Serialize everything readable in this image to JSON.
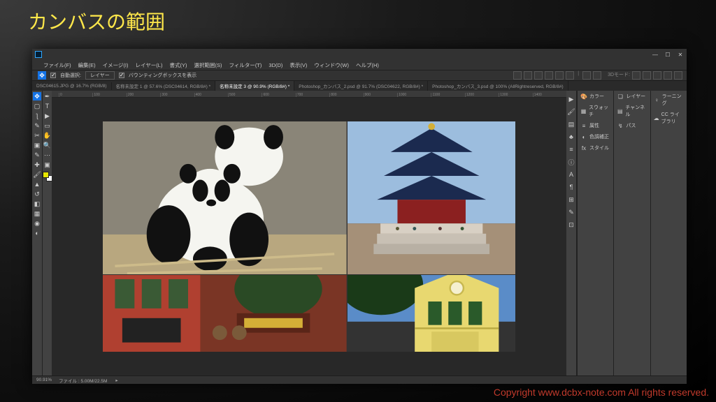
{
  "overlay": {
    "title": "カンバスの範囲",
    "copyright": "Copyright www.dcbx-note.com All rights reserved."
  },
  "menu": {
    "items": [
      "ファイル(F)",
      "編集(E)",
      "イメージ(I)",
      "レイヤー(L)",
      "書式(Y)",
      "選択範囲(S)",
      "フィルター(T)",
      "3D(D)",
      "表示(V)",
      "ウィンドウ(W)",
      "ヘルプ(H)"
    ]
  },
  "options": {
    "auto_select_label": "自動選択:",
    "auto_select_target": "レイヤー",
    "bbox_label": "バウンティングボックスを表示",
    "mode_label": "3Dモード:"
  },
  "tabs": [
    {
      "label": "DSC04615.JPG @ 16.7% (RGB/8)",
      "active": false
    },
    {
      "label": "名称未設定 1 @ 57.6% (DSC04614, RGB/8#) *",
      "active": false
    },
    {
      "label": "名称未設定 3 @ 90.9% (RGB/8#) *",
      "active": true
    },
    {
      "label": "Photoshop_カンバス_2.psd @ 91.7% (DSC04622, RGB/8#) *",
      "active": false
    },
    {
      "label": "Photoshop_カンバス_3.psd @ 100% (AllRightreserved, RGB/8#)",
      "active": false
    }
  ],
  "ruler_marks": [
    "0",
    "100",
    "200",
    "300",
    "400",
    "500",
    "600",
    "700",
    "800",
    "900",
    "1000",
    "1100",
    "1200",
    "1300",
    "1400"
  ],
  "panels": {
    "col1": [
      {
        "icon": "🎨",
        "label": "カラー"
      },
      {
        "icon": "▦",
        "label": "スウォッチ"
      },
      {
        "icon": "≡",
        "label": "属性"
      },
      {
        "icon": "◐",
        "label": "色調補正"
      },
      {
        "icon": "fx",
        "label": "スタイル"
      }
    ],
    "col2": [
      {
        "icon": "❏",
        "label": "レイヤー"
      },
      {
        "icon": "▤",
        "label": "チャンネル"
      },
      {
        "icon": "↯",
        "label": "パス"
      }
    ],
    "col3": [
      {
        "icon": "♀",
        "label": "ラーニング"
      },
      {
        "icon": "☁",
        "label": "CC ライブラリ"
      }
    ]
  },
  "status": {
    "zoom": "90.91%",
    "info": "ファイル : 5.00M/22.5M"
  },
  "window_controls": {
    "min": "—",
    "max": "☐",
    "close": "✕"
  }
}
